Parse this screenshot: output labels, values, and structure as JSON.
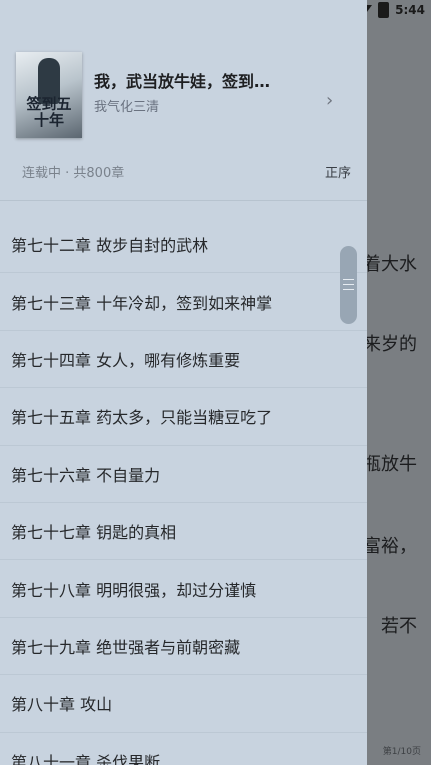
{
  "status_bar": {
    "time": "5:44"
  },
  "reader": {
    "lines": [
      "着大水",
      "来岁的",
      "瓶放牛",
      "富裕，",
      "若不"
    ],
    "page_indicator": "第1/10页"
  },
  "book": {
    "cover_text": "签到五十年",
    "title": "我，武当放牛娃，签到…",
    "author": "我气化三清",
    "status": "连载中 · 共800章",
    "sort_label": "正序"
  },
  "chapters": [
    "第七十二章 故步自封的武林",
    "第七十三章 十年冷却，签到如来神掌",
    "第七十四章 女人，哪有修炼重要",
    "第七十五章 药太多，只能当糖豆吃了",
    "第七十六章 不自量力",
    "第七十七章 钥匙的真相",
    "第七十八章 明明很强，却过分谨慎",
    "第七十九章 绝世强者与前朝密藏",
    "第八十章 攻山",
    "第八十一章 杀伐果断"
  ]
}
